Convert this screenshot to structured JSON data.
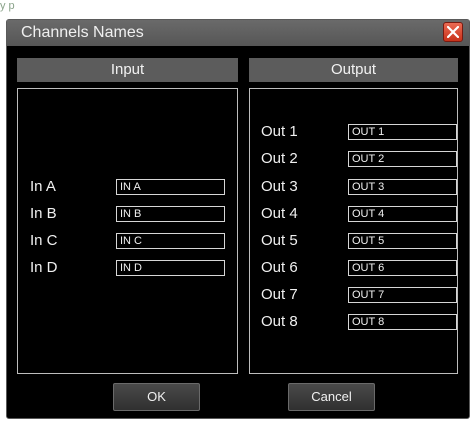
{
  "top_strip": {
    "text": "y p"
  },
  "dialog": {
    "title": "Channels Names",
    "close_icon": "close-x-icon",
    "close_color": "#d9472e"
  },
  "input": {
    "header": "Input",
    "rows": [
      {
        "label": "In A",
        "value": "IN A"
      },
      {
        "label": "In B",
        "value": "IN B"
      },
      {
        "label": "In C",
        "value": "IN C"
      },
      {
        "label": "In D",
        "value": "IN D"
      }
    ]
  },
  "output": {
    "header": "Output",
    "rows": [
      {
        "label": "Out 1",
        "value": "OUT 1"
      },
      {
        "label": "Out 2",
        "value": "OUT 2"
      },
      {
        "label": "Out 3",
        "value": "OUT 3"
      },
      {
        "label": "Out 4",
        "value": "OUT 4"
      },
      {
        "label": "Out 5",
        "value": "OUT 5"
      },
      {
        "label": "Out 6",
        "value": "OUT 6"
      },
      {
        "label": "Out 7",
        "value": "OUT 7"
      },
      {
        "label": "Out 8",
        "value": "OUT 8"
      }
    ]
  },
  "buttons": {
    "ok": "OK",
    "cancel": "Cancel"
  }
}
